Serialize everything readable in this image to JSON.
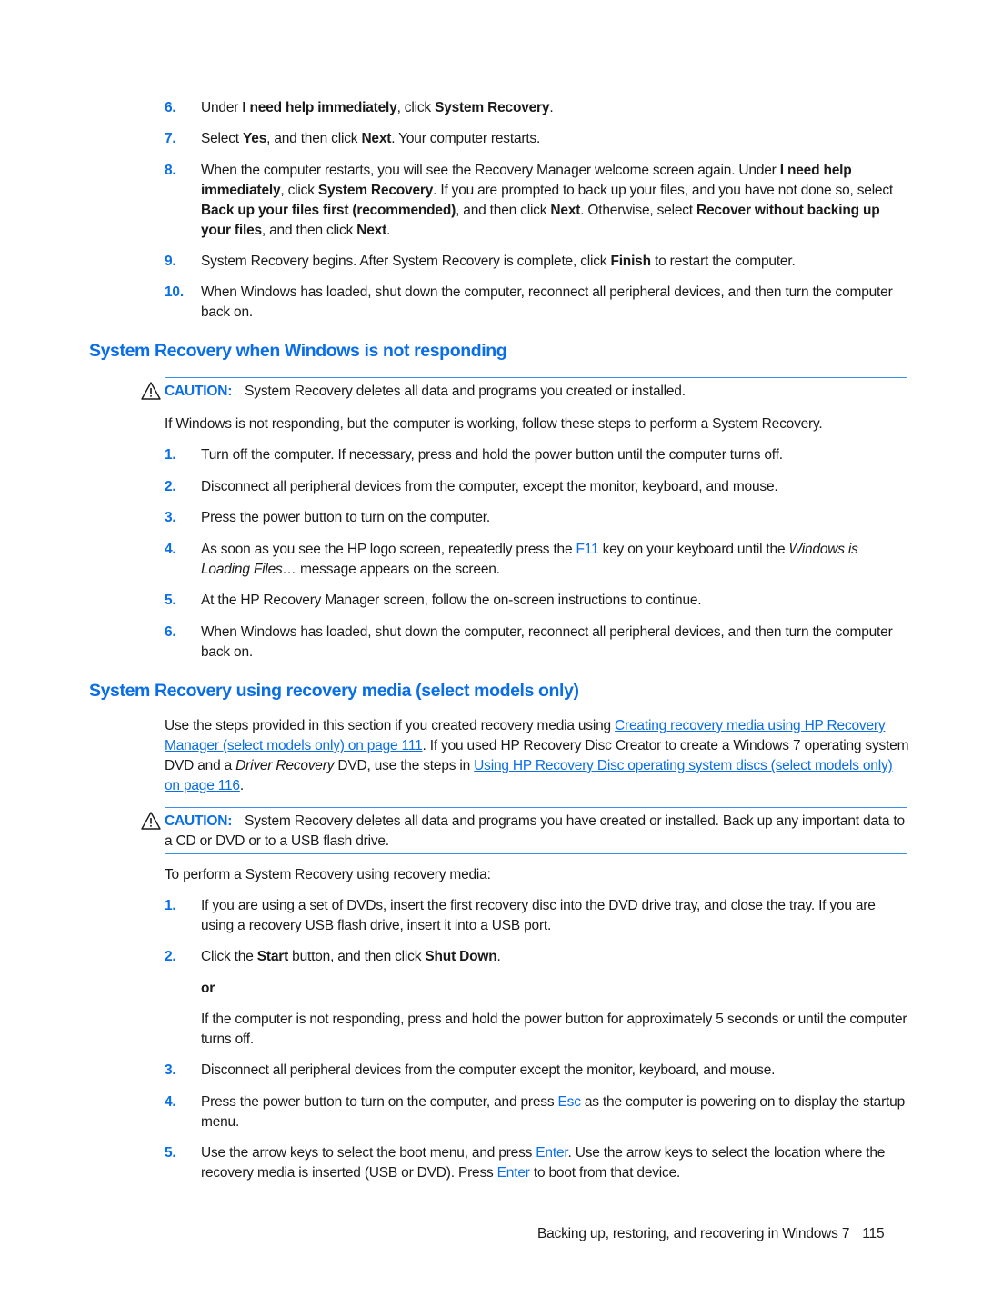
{
  "steps_top": [
    {
      "num": "6.",
      "parts": [
        [
          "t",
          "Under "
        ],
        [
          "b",
          "I need help immediately"
        ],
        [
          "t",
          ", click "
        ],
        [
          "b",
          "System Recovery"
        ],
        [
          "t",
          "."
        ]
      ]
    },
    {
      "num": "7.",
      "parts": [
        [
          "t",
          "Select "
        ],
        [
          "b",
          "Yes"
        ],
        [
          "t",
          ", and then click "
        ],
        [
          "b",
          "Next"
        ],
        [
          "t",
          ". Your computer restarts."
        ]
      ]
    },
    {
      "num": "8.",
      "parts": [
        [
          "t",
          "When the computer restarts, you will see the Recovery Manager welcome screen again. Under "
        ],
        [
          "b",
          "I need help immediately"
        ],
        [
          "t",
          ", click "
        ],
        [
          "b",
          "System Recovery"
        ],
        [
          "t",
          ". If you are prompted to back up your files, and you have not done so, select "
        ],
        [
          "b",
          "Back up your files first (recommended)"
        ],
        [
          "t",
          ", and then click "
        ],
        [
          "b",
          "Next"
        ],
        [
          "t",
          ". Otherwise, select "
        ],
        [
          "b",
          "Recover without backing up your files"
        ],
        [
          "t",
          ", and then click "
        ],
        [
          "b",
          "Next"
        ],
        [
          "t",
          "."
        ]
      ]
    },
    {
      "num": "9.",
      "parts": [
        [
          "t",
          "System Recovery begins. After System Recovery is complete, click "
        ],
        [
          "b",
          "Finish"
        ],
        [
          "t",
          " to restart the computer."
        ]
      ]
    },
    {
      "num": "10.",
      "parts": [
        [
          "t",
          "When Windows has loaded, shut down the computer, reconnect all peripheral devices, and then turn the computer back on."
        ]
      ]
    }
  ],
  "section1": {
    "heading": "System Recovery when Windows is not responding",
    "caution_label": "CAUTION:",
    "caution_text": "System Recovery deletes all data and programs you created or installed.",
    "intro": "If Windows is not responding, but the computer is working, follow these steps to perform a System Recovery.",
    "steps": [
      {
        "num": "1.",
        "parts": [
          [
            "t",
            "Turn off the computer. If necessary, press and hold the power button until the computer turns off."
          ]
        ]
      },
      {
        "num": "2.",
        "parts": [
          [
            "t",
            "Disconnect all peripheral devices from the computer, except the monitor, keyboard, and mouse."
          ]
        ]
      },
      {
        "num": "3.",
        "parts": [
          [
            "t",
            "Press the power button to turn on the computer."
          ]
        ]
      },
      {
        "num": "4.",
        "parts": [
          [
            "t",
            "As soon as you see the HP logo screen, repeatedly press the "
          ],
          [
            "k",
            "F11"
          ],
          [
            "t",
            " key on your keyboard until the "
          ],
          [
            "i",
            "Windows is Loading Files…"
          ],
          [
            "t",
            " message appears on the screen."
          ]
        ]
      },
      {
        "num": "5.",
        "parts": [
          [
            "t",
            "At the HP Recovery Manager screen, follow the on-screen instructions to continue."
          ]
        ]
      },
      {
        "num": "6.",
        "parts": [
          [
            "t",
            "When Windows has loaded, shut down the computer, reconnect all peripheral devices, and then turn the computer back on."
          ]
        ]
      }
    ]
  },
  "section2": {
    "heading": "System Recovery using recovery media (select models only)",
    "intro_parts": [
      [
        "t",
        "Use the steps provided in this section if you created recovery media using "
      ],
      [
        "l",
        "Creating recovery media using HP Recovery Manager (select models only) on page 111"
      ],
      [
        "t",
        ". If you used HP Recovery Disc Creator to create a Windows 7 operating system DVD and a "
      ],
      [
        "i",
        "Driver Recovery"
      ],
      [
        "t",
        " DVD, use the steps in "
      ],
      [
        "l",
        "Using HP Recovery Disc operating system discs (select models only) on page 116"
      ],
      [
        "t",
        "."
      ]
    ],
    "caution_label": "CAUTION:",
    "caution_text": "System Recovery deletes all data and programs you have created or installed. Back up any important data to a CD or DVD or to a USB flash drive.",
    "lead": "To perform a System Recovery using recovery media:",
    "steps": [
      {
        "num": "1.",
        "parts": [
          [
            "t",
            "If you are using a set of DVDs, insert the first recovery disc into the DVD drive tray, and close the tray. If you are using a recovery USB flash drive, insert it into a USB port."
          ]
        ]
      },
      {
        "num": "2.",
        "parts": [
          [
            "t",
            "Click the "
          ],
          [
            "b",
            "Start"
          ],
          [
            "t",
            " button, and then click "
          ],
          [
            "b",
            "Shut Down"
          ],
          [
            "t",
            "."
          ]
        ]
      },
      {
        "num": "3.",
        "parts": [
          [
            "t",
            "Disconnect all peripheral devices from the computer except the monitor, keyboard, and mouse."
          ]
        ]
      },
      {
        "num": "4.",
        "parts": [
          [
            "t",
            "Press the power button to turn on the computer, and press "
          ],
          [
            "k",
            "Esc"
          ],
          [
            "t",
            " as the computer is powering on to display the startup menu."
          ]
        ]
      },
      {
        "num": "5.",
        "parts": [
          [
            "t",
            "Use the arrow keys to select the boot menu, and press "
          ],
          [
            "k",
            "Enter"
          ],
          [
            "t",
            ". Use the arrow keys to select the location where the recovery media is inserted (USB or DVD). Press "
          ],
          [
            "k",
            "Enter"
          ],
          [
            "t",
            " to boot from that device."
          ]
        ]
      }
    ],
    "or_label": "or",
    "alt_text": "If the computer is not responding, press and hold the power button for approximately 5 seconds or until the computer turns off."
  },
  "footer": {
    "chapter": "Backing up, restoring, and recovering in Windows 7",
    "page": "115"
  },
  "colors": {
    "accent": "#0a6ee6",
    "rule": "#3a8ee8",
    "text": "#1a1a1a"
  }
}
